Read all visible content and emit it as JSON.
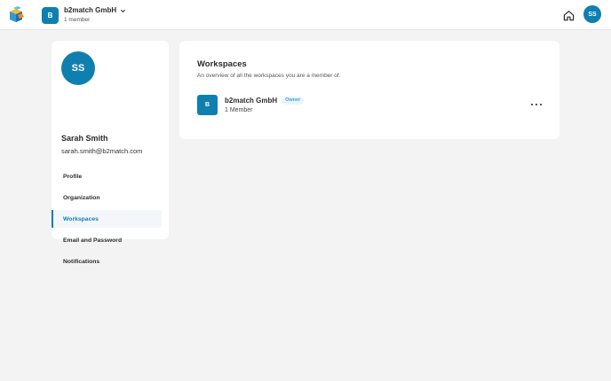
{
  "header": {
    "workspace": {
      "avatar_letter": "B",
      "name": "b2match GmbH",
      "members": "1 member"
    },
    "user_initials": "SS"
  },
  "profile": {
    "initials": "SS",
    "name": "Sarah Smith",
    "email": "sarah.smith@b2match.com",
    "nav": [
      {
        "label": "Profile"
      },
      {
        "label": "Organization"
      },
      {
        "label": "Workspaces"
      },
      {
        "label": "Email and Password"
      },
      {
        "label": "Notifications"
      }
    ]
  },
  "workspaces": {
    "title": "Workspaces",
    "description": "An overview of all the workspaces you are a member of.",
    "items": [
      {
        "avatar_letter": "B",
        "name": "b2match GmbH",
        "role": "Owner",
        "members": "1 Member"
      }
    ]
  },
  "colors": {
    "accent": "#0f7fb0",
    "background": "#f3f3f3"
  },
  "icons": [
    "app-logo-icon",
    "chevron-down-icon",
    "home-icon",
    "more-options-icon"
  ]
}
